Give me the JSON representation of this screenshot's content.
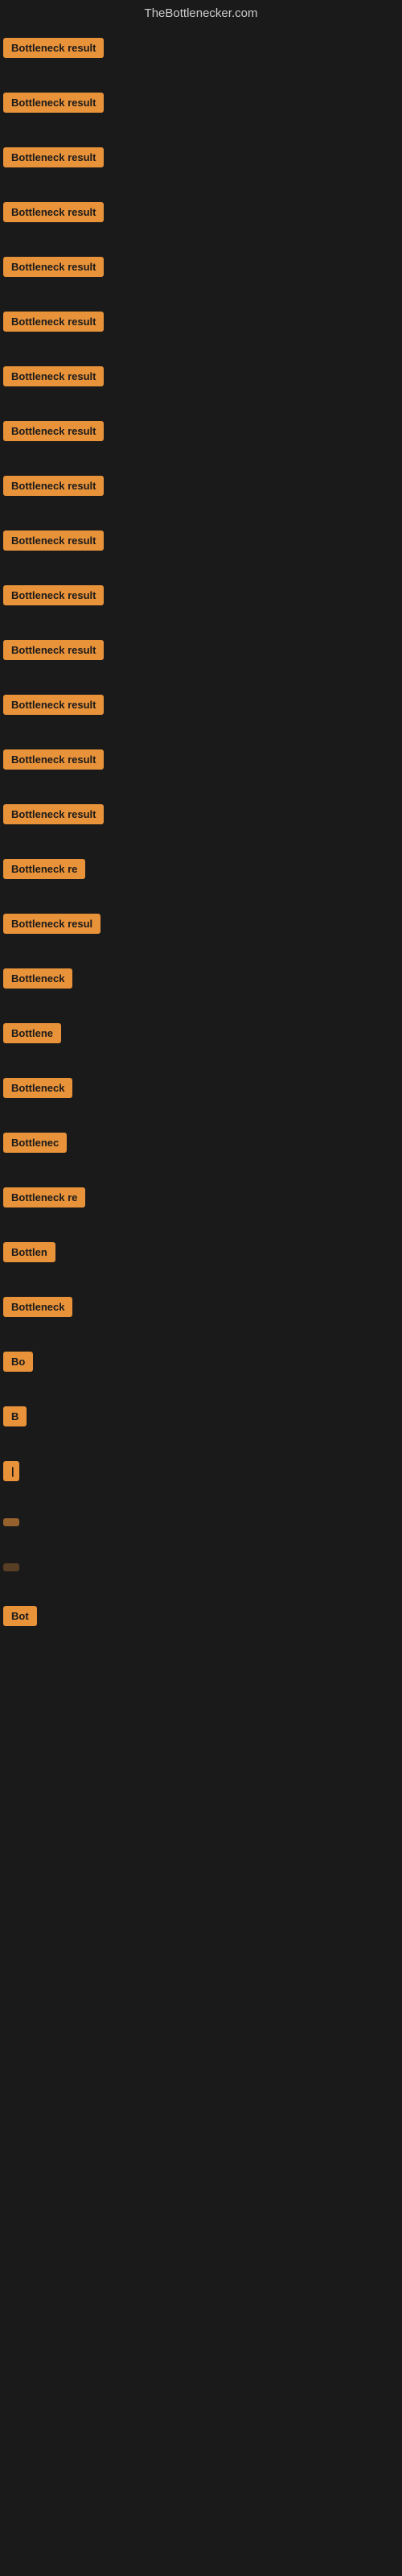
{
  "header": {
    "title": "TheBottlenecker.com"
  },
  "items": [
    {
      "id": 1,
      "label": "Bottleneck result"
    },
    {
      "id": 2,
      "label": "Bottleneck result"
    },
    {
      "id": 3,
      "label": "Bottleneck result"
    },
    {
      "id": 4,
      "label": "Bottleneck result"
    },
    {
      "id": 5,
      "label": "Bottleneck result"
    },
    {
      "id": 6,
      "label": "Bottleneck result"
    },
    {
      "id": 7,
      "label": "Bottleneck result"
    },
    {
      "id": 8,
      "label": "Bottleneck result"
    },
    {
      "id": 9,
      "label": "Bottleneck result"
    },
    {
      "id": 10,
      "label": "Bottleneck result"
    },
    {
      "id": 11,
      "label": "Bottleneck result"
    },
    {
      "id": 12,
      "label": "Bottleneck result"
    },
    {
      "id": 13,
      "label": "Bottleneck result"
    },
    {
      "id": 14,
      "label": "Bottleneck result"
    },
    {
      "id": 15,
      "label": "Bottleneck result"
    },
    {
      "id": 16,
      "label": "Bottleneck re"
    },
    {
      "id": 17,
      "label": "Bottleneck resul"
    },
    {
      "id": 18,
      "label": "Bottleneck"
    },
    {
      "id": 19,
      "label": "Bottlene"
    },
    {
      "id": 20,
      "label": "Bottleneck"
    },
    {
      "id": 21,
      "label": "Bottlenec"
    },
    {
      "id": 22,
      "label": "Bottleneck re"
    },
    {
      "id": 23,
      "label": "Bottlen"
    },
    {
      "id": 24,
      "label": "Bottleneck"
    },
    {
      "id": 25,
      "label": "Bo"
    },
    {
      "id": 26,
      "label": "B"
    },
    {
      "id": 27,
      "label": "|"
    },
    {
      "id": 28,
      "label": ""
    },
    {
      "id": 29,
      "label": ""
    },
    {
      "id": 30,
      "label": "Bot"
    }
  ],
  "badge_color": "#e8923a"
}
